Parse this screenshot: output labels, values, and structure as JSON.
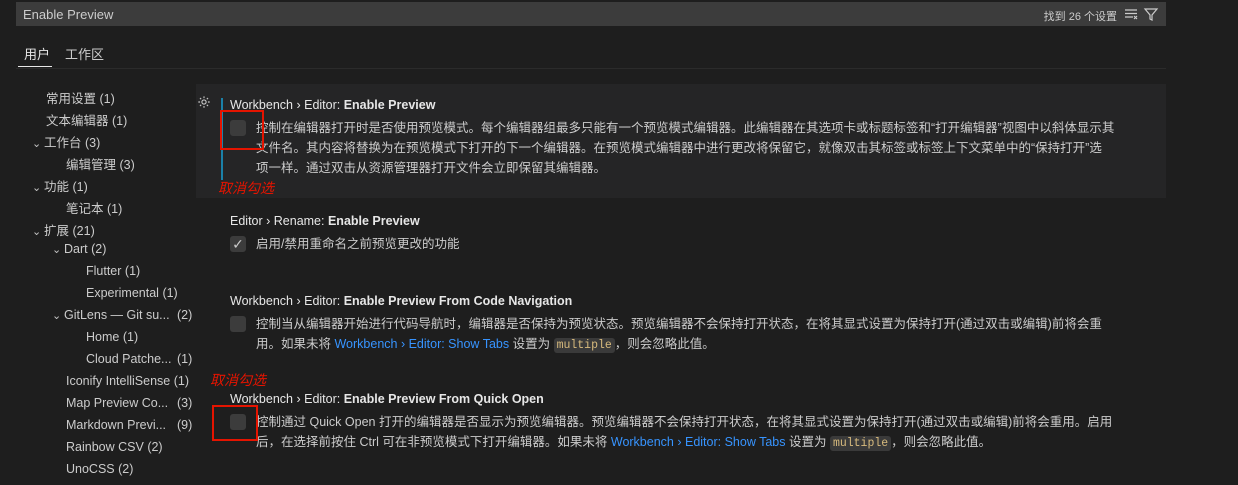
{
  "search": {
    "value": "Enable Preview",
    "count": "找到 26 个设置"
  },
  "scope_tabs": [
    "用户",
    "工作区"
  ],
  "toc": [
    {
      "label": "常用设置",
      "count": "(1)"
    },
    {
      "label": "文本编辑器",
      "count": "(1)"
    },
    {
      "label": "工作台",
      "count": "(3)"
    },
    {
      "label": "编辑管理",
      "count": "(3)"
    },
    {
      "label": "功能",
      "count": "(1)"
    },
    {
      "label": "笔记本",
      "count": "(1)"
    },
    {
      "label": "扩展",
      "count": "(21)"
    },
    {
      "label": "Dart",
      "count": "(2)"
    },
    {
      "label": "Flutter",
      "count": "(1)"
    },
    {
      "label": "Experimental",
      "count": "(1)"
    },
    {
      "label": "GitLens — Git su...",
      "count": "(2)"
    },
    {
      "label": "Home",
      "count": "(1)"
    },
    {
      "label": "Cloud Patche...",
      "count": "(1)"
    },
    {
      "label": "Iconify IntelliSense",
      "count": "(1)"
    },
    {
      "label": "Map Preview Co...",
      "count": "(3)"
    },
    {
      "label": "Markdown Previ...",
      "count": "(9)"
    },
    {
      "label": "Rainbow CSV",
      "count": "(2)"
    },
    {
      "label": "UnoCSS",
      "count": "(2)"
    }
  ],
  "settings": [
    {
      "category": "Workbench › Editor: ",
      "name": "Enable Preview",
      "desc_1": "控制在编辑器打开时是否使用预览模式。每个编辑器组最多只能有一个预览模式编辑器。此编辑器在其选项卡或标题标签和“打开编辑器”视图中以斜体显示其",
      "desc_2": "文件名。其内容将替换为在预览模式下打开的下一个编辑器。在预览模式编辑器中进行更改将保留它，就像双击其标签或标签上下文菜单中的“保持打开”选",
      "desc_3": "项一样。通过双击从资源管理器打开文件会立即保留其编辑器。"
    },
    {
      "category": "Editor › Rename: ",
      "name": "Enable Preview",
      "desc_1": "启用/禁用重命名之前预览更改的功能"
    },
    {
      "category": "Workbench › Editor: ",
      "name": "Enable Preview From Code Navigation",
      "desc_1": "控制当从编辑器开始进行代码导航时，编辑器是否保持为预览状态。预览编辑器不会保持打开状态，在将其显式设置为保持打开(通过双击或编辑)前将会重",
      "desc_2a": "用。如果未将 ",
      "link": "Workbench › Editor: Show Tabs",
      "desc_2b": " 设置为 ",
      "code": "multiple",
      "desc_2c": "，则会忽略此值。"
    },
    {
      "category": "Workbench › Editor: ",
      "name": "Enable Preview From Quick Open",
      "desc_1": "控制通过 Quick Open 打开的编辑器是否显示为预览编辑器。预览编辑器不会保持打开状态，在将其显式设置为保持打开(通过双击或编辑)前将会重用。启用",
      "desc_2a": "后，在选择前按住 Ctrl 可在非预览模式下打开编辑器。如果未将 ",
      "link": "Workbench › Editor: Show Tabs",
      "desc_2b": " 设置为 ",
      "code": "multiple",
      "desc_2c": "，则会忽略此值。"
    }
  ],
  "annotations": [
    "取消勾选",
    "取消勾选"
  ],
  "colors": {
    "accent": "#1b81a8",
    "link": "#3794ff",
    "annotation": "#e51400"
  }
}
